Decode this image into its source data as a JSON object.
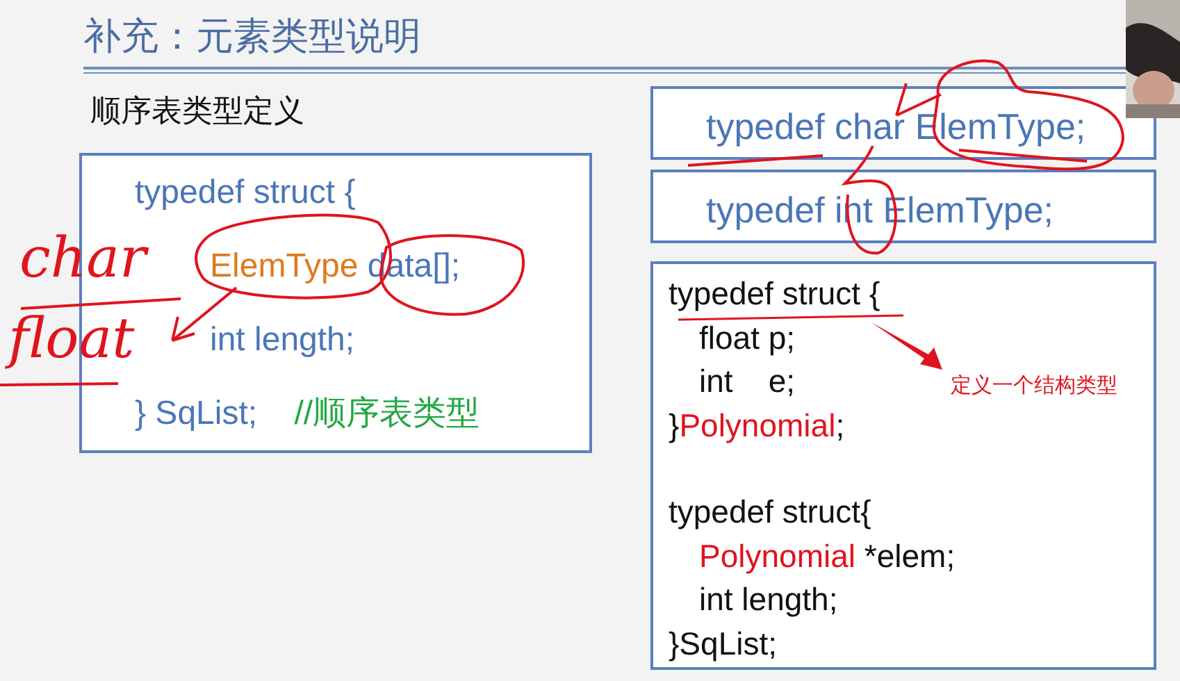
{
  "title": "补充：元素类型说明",
  "left": {
    "heading": "顺序表类型定义",
    "lines": [
      {
        "indented": false,
        "parts": [
          {
            "kind": "code",
            "text": "typedef struct {"
          }
        ]
      },
      {
        "indented": true,
        "parts": [
          {
            "kind": "type",
            "text": "ElemType"
          },
          {
            "kind": "code",
            "text": " data[];"
          }
        ]
      },
      {
        "indented": true,
        "parts": [
          {
            "kind": "code",
            "text": "int length;"
          }
        ]
      },
      {
        "indented": false,
        "parts": [
          {
            "kind": "code",
            "text": "} SqList;    "
          },
          {
            "kind": "comment",
            "text": "//顺序表类型"
          }
        ]
      }
    ]
  },
  "handwriting": [
    "char",
    "float"
  ],
  "type_boxes": [
    "typedef char ElemType;",
    "typedef int ElemType;"
  ],
  "struct_box": {
    "callout": "定义一个结构类型",
    "blocks": [
      [
        {
          "indented": false,
          "parts": [
            {
              "kind": "code",
              "text": "typedef struct {"
            }
          ]
        },
        {
          "indented": true,
          "parts": [
            {
              "kind": "code",
              "text": "float p;"
            }
          ]
        },
        {
          "indented": true,
          "parts": [
            {
              "kind": "code",
              "text": "int    e;"
            }
          ]
        },
        {
          "indented": false,
          "parts": [
            {
              "kind": "code",
              "text": "}"
            },
            {
              "kind": "highlight",
              "text": "Polynomial"
            },
            {
              "kind": "code",
              "text": ";"
            }
          ]
        }
      ],
      [
        {
          "indented": false,
          "parts": [
            {
              "kind": "code",
              "text": "typedef struct{"
            }
          ]
        },
        {
          "indented": true,
          "parts": [
            {
              "kind": "highlight",
              "text": "Polynomial"
            },
            {
              "kind": "code",
              "text": " *elem;"
            }
          ]
        },
        {
          "indented": true,
          "parts": [
            {
              "kind": "code",
              "text": "int length;"
            }
          ]
        },
        {
          "indented": false,
          "parts": [
            {
              "kind": "code",
              "text": "}SqList;"
            }
          ]
        }
      ]
    ]
  }
}
